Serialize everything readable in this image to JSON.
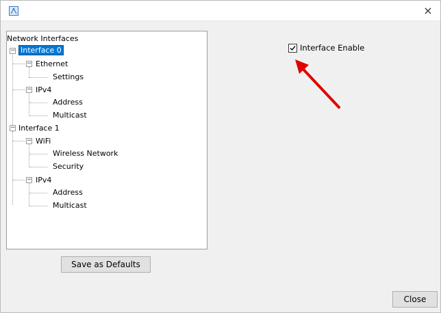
{
  "window": {
    "close_glyph": "×",
    "app_icon": "app-icon"
  },
  "tree": {
    "root_label": "Network Interfaces",
    "interfaces": [
      {
        "label": "Interface 0",
        "selected": true,
        "groups": [
          {
            "label": "Ethernet",
            "children": [
              "Settings"
            ]
          },
          {
            "label": "IPv4",
            "children": [
              "Address",
              "Multicast"
            ]
          }
        ]
      },
      {
        "label": "Interface 1",
        "selected": false,
        "groups": [
          {
            "label": "WiFi",
            "children": [
              "Wireless Network",
              "Security"
            ]
          },
          {
            "label": "IPv4",
            "children": [
              "Address",
              "Multicast"
            ]
          }
        ]
      }
    ]
  },
  "options": {
    "interface_enable_label": "Interface Enable",
    "interface_enable_checked": true
  },
  "buttons": {
    "save_defaults_label": "Save as Defaults",
    "close_label": "Close"
  },
  "colors": {
    "selection": "#0078d7",
    "annotation_arrow": "#e00000"
  }
}
